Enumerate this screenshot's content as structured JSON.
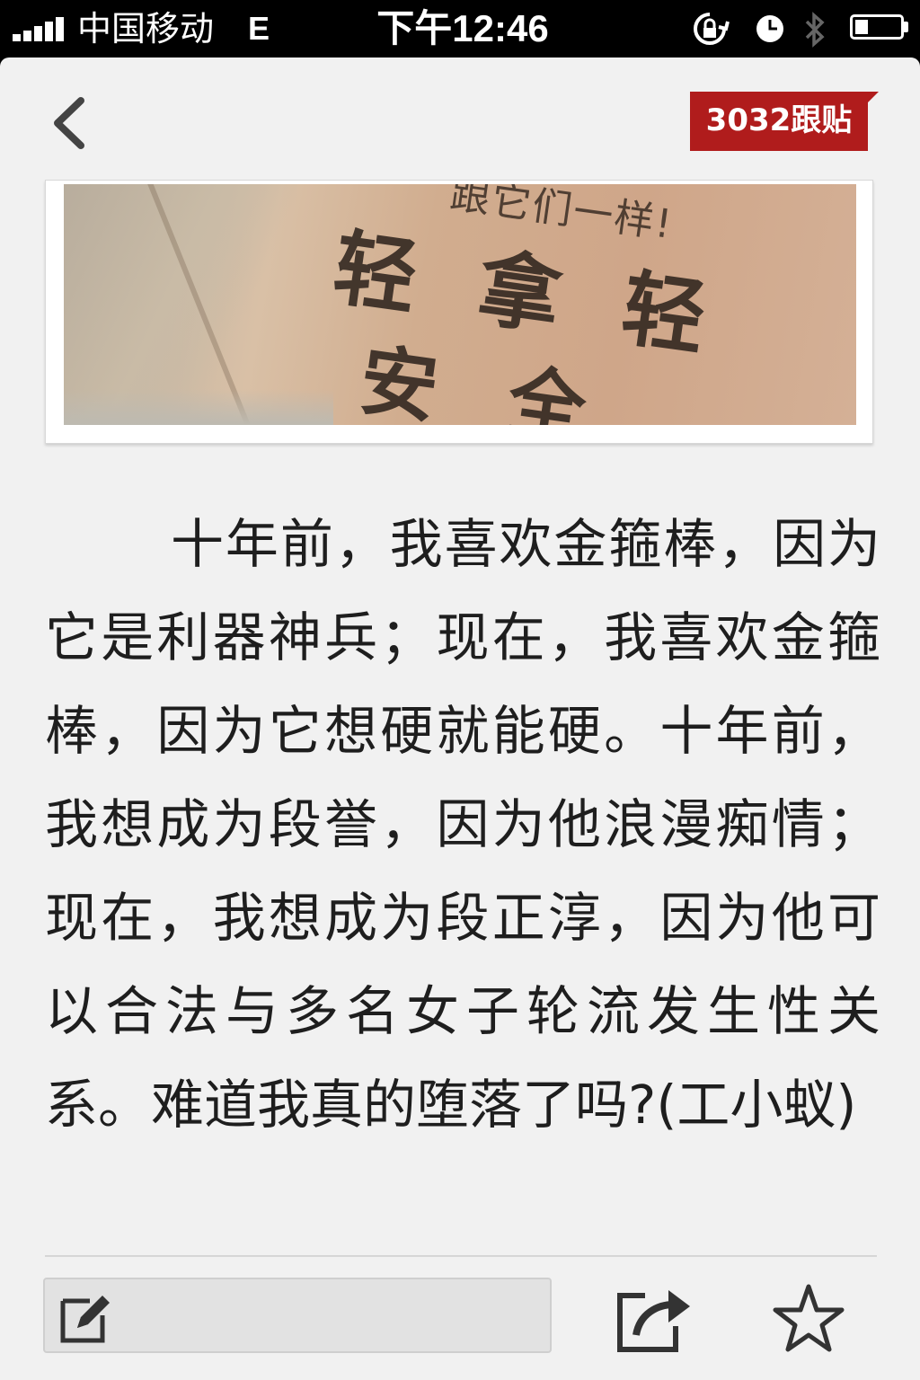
{
  "status_bar": {
    "carrier": "中国移动",
    "network": "E",
    "time": "下午12:46"
  },
  "header": {
    "back_icon": "chevron-left-icon",
    "comment_count_label": "3032跟贴",
    "accent_color": "#b01c1c"
  },
  "article": {
    "image_text": {
      "line_small": "跟它们一样!",
      "line1": "轻拿轻",
      "line2": "安全"
    },
    "body": "十年前，我喜欢金箍棒，因为它是利器神兵；现在，我喜欢金箍棒，因为它想硬就能硬。十年前，我想成为段誉，因为他浪漫痴情；现在，我想成为段正淳，因为他可以合法与多名女子轮流发生性关系。难道我真的堕落了吗?(工小蚁)"
  },
  "toolbar": {
    "input_icon": "edit-icon",
    "share_icon": "share-icon",
    "favorite_icon": "star-icon"
  }
}
